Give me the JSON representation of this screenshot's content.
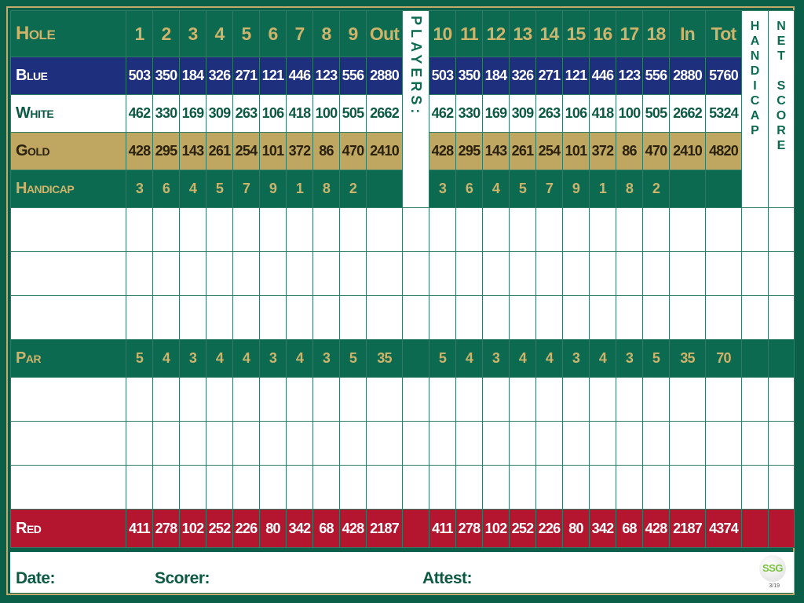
{
  "colors": {
    "green": "#0c6a51",
    "gold_text": "#cdb46a",
    "blue": "#1e2f7d",
    "gold": "#bfa661",
    "red": "#b4162f"
  },
  "header": {
    "label": "Hole",
    "front": [
      "1",
      "2",
      "3",
      "4",
      "5",
      "6",
      "7",
      "8",
      "9"
    ],
    "out": "Out",
    "back": [
      "10",
      "11",
      "12",
      "13",
      "14",
      "15",
      "16",
      "17",
      "18"
    ],
    "in": "In",
    "tot": "Tot"
  },
  "players_label": "PLAYERS:",
  "handicap_col": "HANDICAP",
  "net_score_col": "NET SCORE",
  "rows": [
    {
      "cls": "blue",
      "label": "Blue",
      "front": [
        "503",
        "350",
        "184",
        "326",
        "271",
        "121",
        "446",
        "123",
        "556"
      ],
      "out": "2880",
      "back": [
        "503",
        "350",
        "184",
        "326",
        "271",
        "121",
        "446",
        "123",
        "556"
      ],
      "in": "2880",
      "tot": "5760"
    },
    {
      "cls": "white",
      "label": "White",
      "front": [
        "462",
        "330",
        "169",
        "309",
        "263",
        "106",
        "418",
        "100",
        "505"
      ],
      "out": "2662",
      "back": [
        "462",
        "330",
        "169",
        "309",
        "263",
        "106",
        "418",
        "100",
        "505"
      ],
      "in": "2662",
      "tot": "5324"
    },
    {
      "cls": "gold",
      "label": "Gold",
      "front": [
        "428",
        "295",
        "143",
        "261",
        "254",
        "101",
        "372",
        "86",
        "470"
      ],
      "out": "2410",
      "back": [
        "428",
        "295",
        "143",
        "261",
        "254",
        "101",
        "372",
        "86",
        "470"
      ],
      "in": "2410",
      "tot": "4820"
    },
    {
      "cls": "hcp",
      "label": "Handicap",
      "front": [
        "3",
        "6",
        "4",
        "5",
        "7",
        "9",
        "1",
        "8",
        "2"
      ],
      "out": "",
      "back": [
        "3",
        "6",
        "4",
        "5",
        "7",
        "9",
        "1",
        "8",
        "2"
      ],
      "in": "",
      "tot": ""
    },
    {
      "cls": "blank"
    },
    {
      "cls": "blank"
    },
    {
      "cls": "blank"
    },
    {
      "cls": "par",
      "label": "Par",
      "front": [
        "5",
        "4",
        "3",
        "4",
        "4",
        "3",
        "4",
        "3",
        "5"
      ],
      "out": "35",
      "back": [
        "5",
        "4",
        "3",
        "4",
        "4",
        "3",
        "4",
        "3",
        "5"
      ],
      "in": "35",
      "tot": "70"
    },
    {
      "cls": "blank"
    },
    {
      "cls": "blank"
    },
    {
      "cls": "blank"
    },
    {
      "cls": "red",
      "label": "Red",
      "front": [
        "411",
        "278",
        "102",
        "252",
        "226",
        "80",
        "342",
        "68",
        "428"
      ],
      "out": "2187",
      "back": [
        "411",
        "278",
        "102",
        "252",
        "226",
        "80",
        "342",
        "68",
        "428"
      ],
      "in": "2187",
      "tot": "4374"
    }
  ],
  "footer": {
    "date": "Date:",
    "scorer": "Scorer:",
    "attest": "Attest:",
    "logo": "SSG",
    "logo_sub": "3/19"
  }
}
